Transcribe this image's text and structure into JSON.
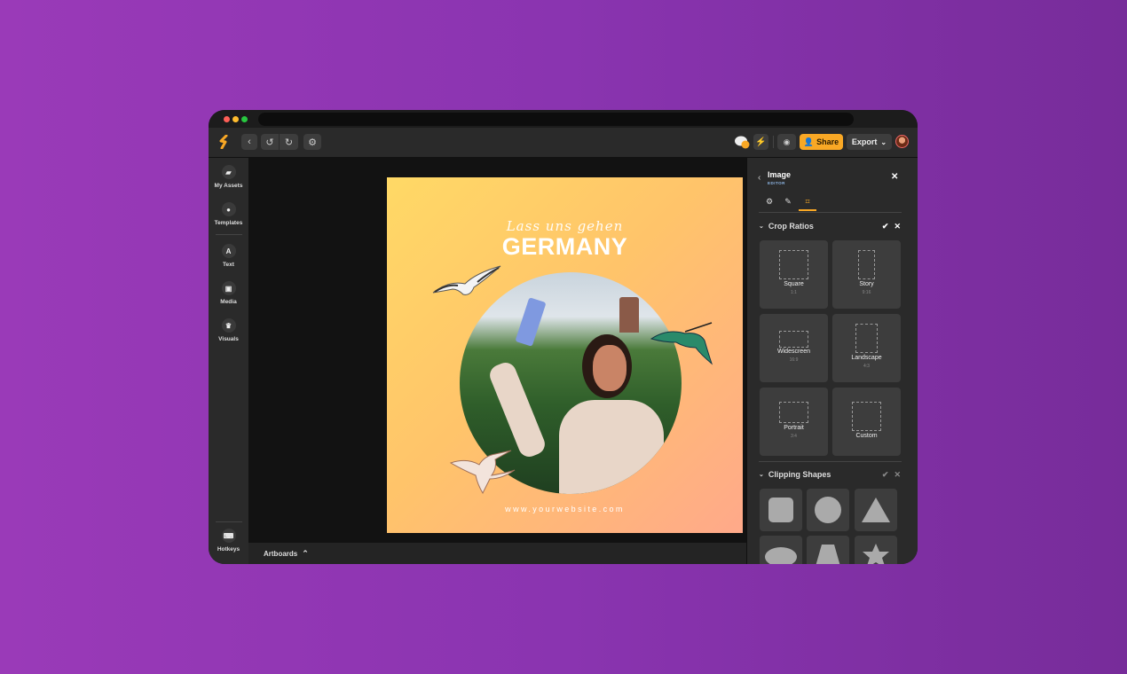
{
  "toolbar": {
    "share_label": "Share",
    "export_label": "Export",
    "accent": "#f9a825"
  },
  "sidebar": {
    "items": [
      {
        "label": "My Assets",
        "icon": "folder-icon"
      },
      {
        "label": "Templates",
        "icon": "templates-icon"
      },
      {
        "label": "Text",
        "icon": "text-icon",
        "glyph": "A"
      },
      {
        "label": "Media",
        "icon": "media-icon"
      },
      {
        "label": "Visuals",
        "icon": "crown-icon"
      }
    ],
    "hotkeys_label": "Hotkeys"
  },
  "canvas": {
    "script_text": "Lass uns gehen",
    "headline": "GERMANY",
    "website": "www.yourwebsite.com"
  },
  "bottombar": {
    "artboards_label": "Artboards"
  },
  "panel": {
    "title": "Image",
    "subtitle": "EDITOR",
    "crop_section": "Crop Ratios",
    "ratios": [
      {
        "name": "Square",
        "ratio": "1:1"
      },
      {
        "name": "Story",
        "ratio": "9:16"
      },
      {
        "name": "Widescreen",
        "ratio": "16:9"
      },
      {
        "name": "Landscape",
        "ratio": "4:3"
      },
      {
        "name": "Portrait",
        "ratio": "3:4"
      },
      {
        "name": "Custom",
        "ratio": ""
      }
    ],
    "clip_section": "Clipping Shapes",
    "shapes": [
      "rounded-square",
      "circle",
      "triangle",
      "ellipse",
      "trapezoid",
      "star"
    ]
  }
}
